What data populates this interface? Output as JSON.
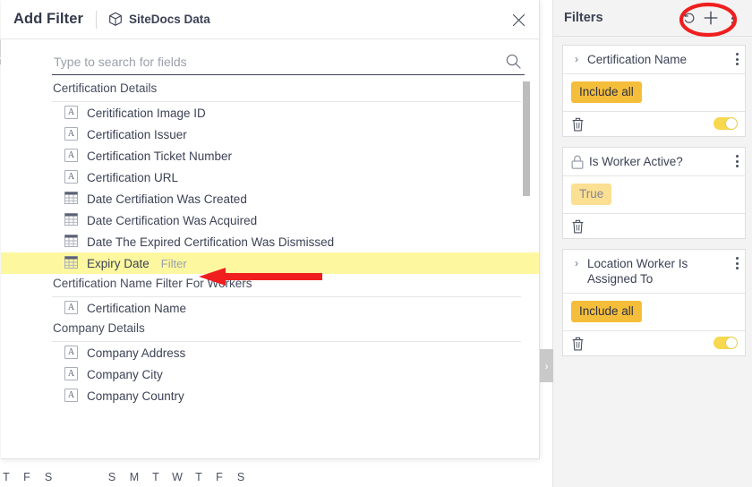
{
  "dialog": {
    "title": "Add Filter",
    "source": "SiteDocs Data",
    "source_icon": "cube-icon",
    "close_icon": "close-icon",
    "search": {
      "placeholder": "Type to search for fields",
      "value": "",
      "icon": "search-icon"
    },
    "groups": [
      {
        "label": "Certification Details",
        "fields": [
          {
            "label": "Ceritification Image ID",
            "type": "text",
            "highlighted": false,
            "action": ""
          },
          {
            "label": "Certification Issuer",
            "type": "text",
            "highlighted": false,
            "action": ""
          },
          {
            "label": "Certification Ticket Number",
            "type": "text",
            "highlighted": false,
            "action": ""
          },
          {
            "label": "Certification URL",
            "type": "text",
            "highlighted": false,
            "action": ""
          },
          {
            "label": "Date Certifiation Was Created",
            "type": "date",
            "highlighted": false,
            "action": ""
          },
          {
            "label": "Date Certification Was Acquired",
            "type": "date",
            "highlighted": false,
            "action": ""
          },
          {
            "label": "Date The Expired Certification Was Dismissed",
            "type": "date",
            "highlighted": false,
            "action": ""
          },
          {
            "label": "Expiry Date",
            "type": "date",
            "highlighted": true,
            "action": "Filter"
          }
        ]
      },
      {
        "label": "Certification Name Filter For Workers",
        "fields": [
          {
            "label": "Certification Name",
            "type": "text",
            "highlighted": false,
            "action": ""
          }
        ]
      },
      {
        "label": "Company Details",
        "fields": [
          {
            "label": "Company Address",
            "type": "text",
            "highlighted": false,
            "action": ""
          },
          {
            "label": "Company City",
            "type": "text",
            "highlighted": false,
            "action": ""
          },
          {
            "label": "Company Country",
            "type": "text",
            "highlighted": false,
            "action": ""
          }
        ]
      }
    ]
  },
  "sidebar": {
    "title": "Filters",
    "undo_icon": "undo-icon",
    "add_icon": "plus-icon",
    "menu_icon": "kebab-menu-icon",
    "cards": [
      {
        "name": "Certification Name",
        "lead_icon": "chevron-right-icon",
        "chip": "Include all",
        "chip_muted": false,
        "delete_icon": "trash-icon",
        "has_toggle": true,
        "toggle_on": true
      },
      {
        "name": "Is Worker Active?",
        "lead_icon": "lock-icon",
        "chip": "True",
        "chip_muted": true,
        "delete_icon": "trash-icon",
        "has_toggle": false,
        "toggle_on": false
      },
      {
        "name": "Location Worker Is Assigned To",
        "lead_icon": "chevron-right-icon",
        "chip": "Include all",
        "chip_muted": false,
        "delete_icon": "trash-icon",
        "has_toggle": true,
        "toggle_on": true
      }
    ]
  },
  "background": {
    "calendar_days": [
      "T",
      "F",
      "S",
      "S",
      "M",
      "T",
      "W",
      "T",
      "F",
      "S"
    ],
    "collapse_icon": "chevron-right-icon"
  },
  "annotations": {
    "arrow": "red-arrow-pointing-left",
    "ellipse": "red-ellipse-highlight",
    "color": "#f01e1e"
  },
  "colors": {
    "accent_chip": "#f5be3a",
    "chip_muted": "#fbdf92",
    "highlight_row": "#fdf8a0",
    "toggle_on": "#f7d84e",
    "annotation_red": "#f01e1e",
    "text": "#3b4255",
    "sidebar_bg": "#f3f3f3"
  }
}
